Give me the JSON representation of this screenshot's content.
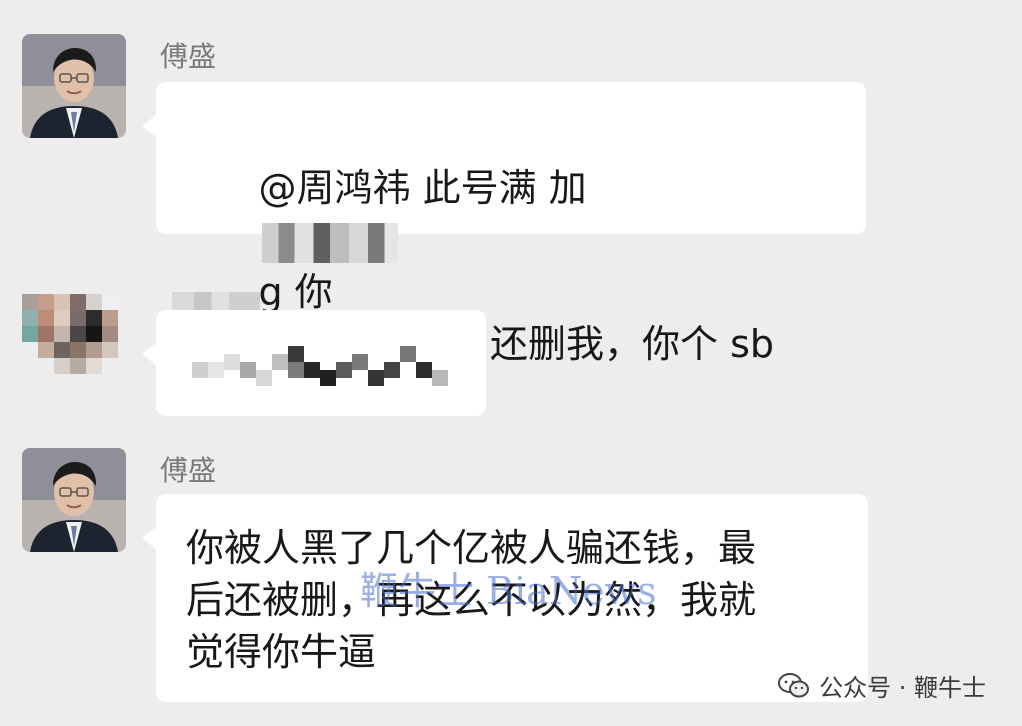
{
  "chat": {
    "messages": [
      {
        "sender": "傅盛",
        "text_before": "@周鸿祎 此号满 加",
        "text_after_redaction": "g 你\n欠我钱，非不还，还删我，你个 sb"
      },
      {
        "sender": "",
        "redacted": true
      },
      {
        "sender": "傅盛",
        "text": "你被人黑了几个亿被人骗还钱，最\n后还被删，再这么不以为然，我就\n觉得你牛逼"
      }
    ]
  },
  "overlay": {
    "watermark": "鞭牛士 BiaNews",
    "source_label": "公众号 · 鞭牛士",
    "source_icon": "wechat-icon"
  },
  "colors": {
    "background": "#ededed",
    "bubble": "#ffffff",
    "sender_name": "#7a7a7a",
    "watermark": "#466ed2"
  }
}
